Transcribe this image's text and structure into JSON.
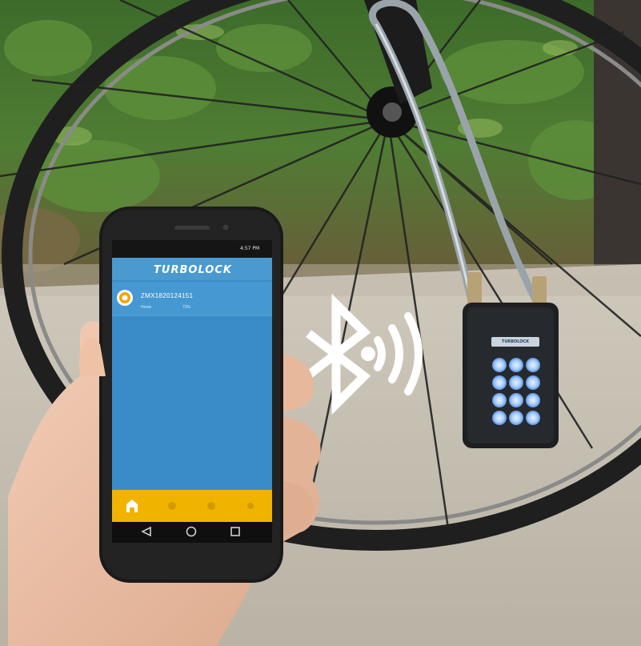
{
  "phone": {
    "status_bar": {
      "time": "4:57 PM"
    },
    "app": {
      "title": "TURBOLOCK",
      "device": {
        "name": "ZMX1820124151",
        "status_left": "Home",
        "status_right": "70%"
      }
    },
    "tab_bar": {
      "items": [
        "home-icon",
        "tab-dot-icon",
        "tab-dot-icon",
        "tab-dot-icon"
      ]
    },
    "system_nav": {
      "items": [
        "back-icon",
        "home-circle-icon",
        "recents-icon"
      ]
    }
  },
  "lock": {
    "brand": "TURBOLOCK",
    "keypad_buttons": 12
  },
  "overlay": {
    "icons": [
      "bluetooth-icon",
      "signal-waves-icon"
    ]
  },
  "colors": {
    "app_header": "#4a9ad0",
    "app_body": "#3a8cc9",
    "tab_bar": "#f0b400",
    "keypad_glow": "#7db6ff",
    "phone_body": "#1a1a1a"
  }
}
